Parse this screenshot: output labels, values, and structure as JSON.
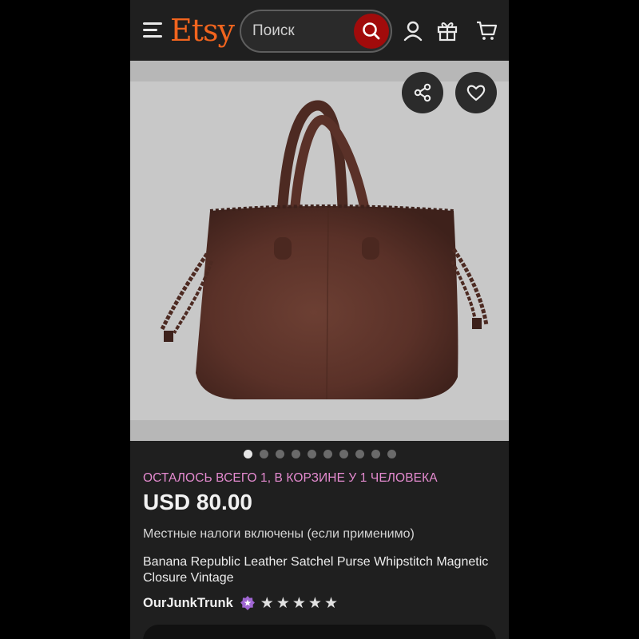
{
  "header": {
    "logo": "Etsy",
    "search_placeholder": "Поиск"
  },
  "listing": {
    "stock_notice": "ОСТАЛОСЬ ВСЕГО 1, В КОРЗИНЕ У 1 ЧЕЛОВЕКА",
    "price": "USD 80.00",
    "tax_note": "Местные налоги включены (если применимо)",
    "title": "Banana Republic Leather Satchel Purse Whipstitch Magnetic Closure Vintage",
    "seller": "OurJunkTrunk",
    "rating": 5,
    "rating_max": 5
  },
  "gallery": {
    "image_count": 10,
    "current_index": 1
  },
  "colors": {
    "brand": "#f1641e",
    "search_button": "#a10b0b",
    "stock_notice": "#e58bd0",
    "star_seller_badge": "#a066d3"
  },
  "icons": [
    "menu-icon",
    "search-icon",
    "account-icon",
    "gift-icon",
    "cart-icon",
    "share-icon",
    "heart-icon",
    "star-seller-icon",
    "star-icon"
  ]
}
